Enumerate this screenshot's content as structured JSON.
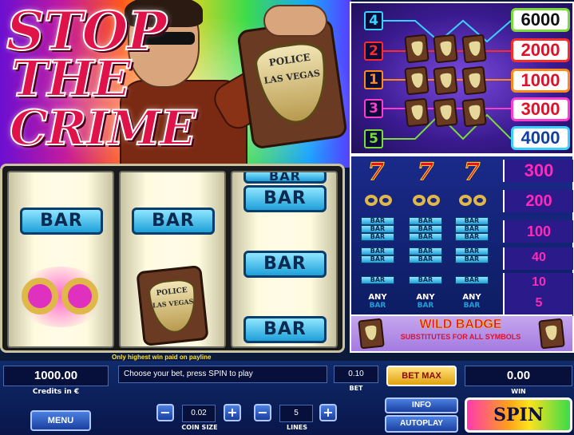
{
  "title": {
    "line1": "STOP",
    "line2": "THE",
    "line3": "CRIME"
  },
  "badge_text": {
    "top": "POLICE",
    "bottom": "LAS VEGAS"
  },
  "reels": {
    "bar_label": "BAR",
    "payline_note": "Only highest win paid on payline"
  },
  "paylines": [
    {
      "number": "4",
      "win": "6000",
      "color": "#3ad0ff"
    },
    {
      "number": "2",
      "win": "2000",
      "color": "#ff2a2a"
    },
    {
      "number": "1",
      "win": "1000",
      "color": "#ff8a1a"
    },
    {
      "number": "3",
      "win": "3000",
      "color": "#ff3ad0"
    },
    {
      "number": "5",
      "win": "4000",
      "color": "#7adc3a"
    }
  ],
  "paytable": {
    "rows": [
      {
        "symbol": "seven",
        "label": "7",
        "pay": "300"
      },
      {
        "symbol": "cuffs",
        "label": "",
        "pay": "200"
      },
      {
        "symbol": "triple-bar",
        "label": "BAR",
        "pay": "100"
      },
      {
        "symbol": "double-bar",
        "label": "BAR",
        "pay": "40"
      },
      {
        "symbol": "single-bar",
        "label": "BAR",
        "pay": "10"
      },
      {
        "symbol": "any-bar",
        "label": "ANY",
        "sub": "BAR",
        "pay": "5"
      }
    ],
    "wild_title": "WILD BADGE",
    "wild_sub": "SUBSTITUTES FOR ALL SYMBOLS"
  },
  "controls": {
    "credits_value": "1000.00",
    "credits_label": "Credits in €",
    "message": "Choose your bet, press SPIN to play",
    "bet_value": "0.10",
    "bet_label": "BET",
    "bet_max": "BET MAX",
    "win_value": "0.00",
    "win_label": "WIN",
    "menu": "MENU",
    "coin_size_value": "0.02",
    "coin_size_label": "COIN SIZE",
    "lines_value": "5",
    "lines_label": "LINES",
    "minus": "−",
    "plus": "+",
    "info": "INFO",
    "autoplay": "AUTOPLAY",
    "spin": "SPIN"
  }
}
